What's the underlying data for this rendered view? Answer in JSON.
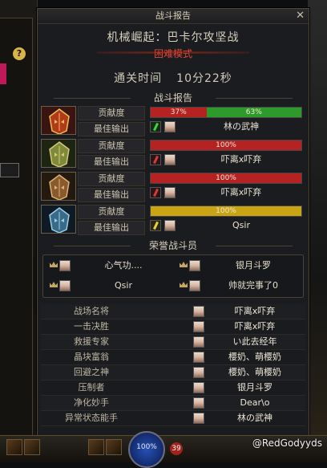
{
  "dialog": {
    "title": "战斗报告",
    "dungeon_name": "机械崛起：巴卡尔攻坚战",
    "difficulty": "困难模式",
    "clear_time_label": "通关时间",
    "clear_time_value": "10分22秒",
    "battle_report_header": "战斗报告",
    "contrib_label": "贡献度",
    "best_output_label": "最佳输出"
  },
  "players": [
    {
      "portrait": "crimson-helm",
      "segments": [
        {
          "text": "37%",
          "value": 37,
          "color": "#b52222"
        },
        {
          "text": "63%",
          "value": 63,
          "color": "#2f9a2c"
        }
      ],
      "weapon": "green",
      "best_name": "林の武神"
    },
    {
      "portrait": "golden-mask",
      "segments": [
        {
          "text": "100%",
          "value": 100,
          "color": "#b52222"
        }
      ],
      "weapon": "red",
      "best_name": "吓离x吓弃"
    },
    {
      "portrait": "bronze-mask",
      "segments": [
        {
          "text": "100%",
          "value": 100,
          "color": "#b52222"
        }
      ],
      "weapon": "red",
      "best_name": "吓离x吓弃"
    },
    {
      "portrait": "steel-mask",
      "segments": [
        {
          "text": "100%",
          "value": 100,
          "color": "#c9a414"
        }
      ],
      "weapon": "yellow",
      "best_name": "Qsir"
    }
  ],
  "honor": {
    "header": "荣誉战斗员",
    "members": [
      "心气功....",
      "银月斗罗",
      "Qsir",
      "帅就完事了0"
    ]
  },
  "awards": [
    {
      "title": "战场名将",
      "name": "吓离x吓弃"
    },
    {
      "title": "一击决胜",
      "name": "吓离x吓弃"
    },
    {
      "title": "救援专家",
      "name": "い此去经年"
    },
    {
      "title": "晶块富翁",
      "name": "樱奶、萌樱奶"
    },
    {
      "title": "回避之神",
      "name": "樱奶、萌樱奶"
    },
    {
      "title": "压制者",
      "name": "银月斗罗"
    },
    {
      "title": "净化妙手",
      "name": "Dear\\o"
    },
    {
      "title": "异常状态能手",
      "name": "林の武神"
    }
  ],
  "hud": {
    "mp_percent": "100%",
    "level": "39"
  },
  "watermark": "@RedGodyyds"
}
